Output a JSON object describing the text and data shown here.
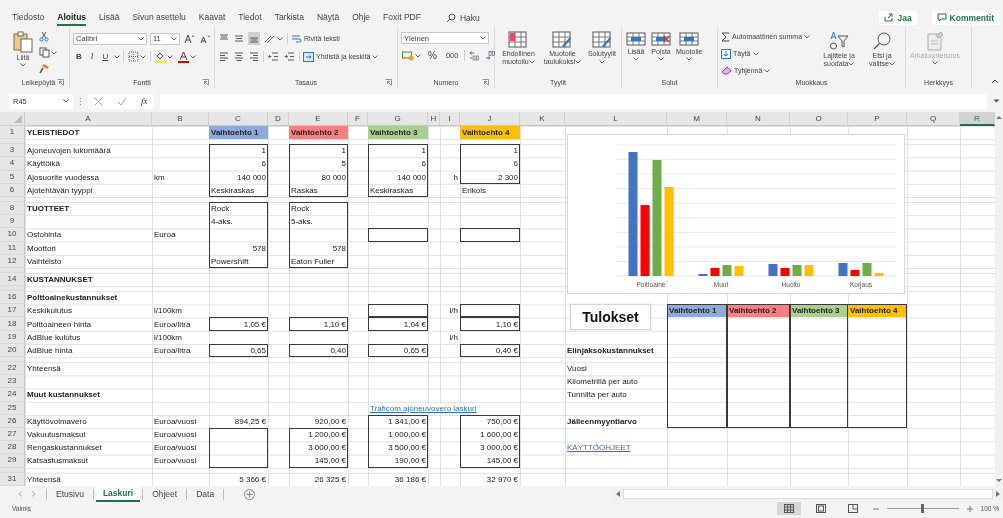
{
  "menu": {
    "tabs": [
      {
        "label": "Tiedosto",
        "selected": false
      },
      {
        "label": "Aloitus",
        "selected": true
      },
      {
        "label": "Lisää",
        "selected": false
      },
      {
        "label": "Sivun asettelu",
        "selected": false
      },
      {
        "label": "Kaavat",
        "selected": false
      },
      {
        "label": "Tiedot",
        "selected": false
      },
      {
        "label": "Tarkista",
        "selected": false
      },
      {
        "label": "Näytä",
        "selected": false
      },
      {
        "label": "Ohje",
        "selected": false
      },
      {
        "label": "Foxit PDF",
        "selected": false
      }
    ],
    "search": "Haku",
    "share": "Jaa",
    "comments": "Kommentit"
  },
  "ribbon": {
    "clipboard": {
      "label": "Leikepöytä",
      "launcher": true,
      "paste": "Liitä"
    },
    "font": {
      "label": "Fontti",
      "launcher": true,
      "family": "Calibri",
      "size": "11",
      "bold": "B",
      "italic": "I",
      "underline": "U"
    },
    "alignment": {
      "label": "Tasaus",
      "launcher": true,
      "vertical": [
        {
          "selected": false
        },
        {
          "selected": false
        },
        {
          "selected": true
        }
      ],
      "wrap": "Rivitä teksti",
      "merge": "Yhdistä ja keskitä"
    },
    "number": {
      "label": "Numero",
      "launcher": true,
      "format": "Yleinen",
      "percent": "%",
      "thousands": "000"
    },
    "styles": {
      "label": "Tyylit",
      "buttons": [
        "Ehdollinen muotoilu",
        "Muotoile taulukoksi",
        "Solutyylit"
      ]
    },
    "cells": {
      "label": "Solut",
      "buttons": [
        "Lisää",
        "Poista",
        "Muotoile"
      ]
    },
    "editing": {
      "label": "Muokkaus",
      "autosum": "Automaattinen summa",
      "fill": "Täytä",
      "clear": "Tyhjennä",
      "sort": "Lajittele ja suodata",
      "find": "Etsi ja valitse"
    },
    "sensitivity": {
      "label": "Herkkyys",
      "button": "Arkaluonteisuus",
      "disabled": true
    }
  },
  "formula_bar": {
    "name_box": "R45",
    "function_label": "fx"
  },
  "sheet": {
    "columns": [
      {
        "label": "A",
        "selected": false
      },
      {
        "label": "B",
        "selected": false
      },
      {
        "label": "C",
        "selected": false
      },
      {
        "label": "D",
        "selected": false
      },
      {
        "label": "E",
        "selected": false
      },
      {
        "label": "F",
        "selected": false
      },
      {
        "label": "G",
        "selected": false
      },
      {
        "label": "H",
        "selected": false
      },
      {
        "label": "I",
        "selected": false
      },
      {
        "label": "J",
        "selected": false
      },
      {
        "label": "K",
        "selected": false
      },
      {
        "label": "L",
        "selected": false
      },
      {
        "label": "M",
        "selected": false
      },
      {
        "label": "N",
        "selected": false
      },
      {
        "label": "O",
        "selected": false
      },
      {
        "label": "P",
        "selected": false
      },
      {
        "label": "Q",
        "selected": false
      },
      {
        "label": "R",
        "selected": true
      }
    ],
    "rows": [
      {
        "number": "1",
        "small": false,
        "cells": {
          "A": {
            "kind": "heading",
            "text": "YLEISTIEDOT"
          },
          "C": {
            "kind": "header",
            "text": "Vaihtoehto 1",
            "color": "#8eaadb"
          },
          "E": {
            "kind": "header",
            "text": "Vaihtoehto 2",
            "color": "#ff7c80"
          },
          "G": {
            "kind": "header",
            "text": "Vaihtoehto 3",
            "color": "#a9d08e"
          },
          "J": {
            "kind": "header",
            "text": "Vaihtoehto 4",
            "color": "#ffc000"
          }
        }
      },
      {
        "small": true
      },
      {
        "number": "3",
        "small": false,
        "cells": {
          "A": {
            "kind": "text",
            "text": "Ajoneuvojen lukumäärä"
          },
          "C": {
            "kind": "number",
            "text": "1"
          },
          "E": {
            "kind": "number",
            "text": "1"
          },
          "G": {
            "kind": "number",
            "text": "1"
          },
          "J": {
            "kind": "number",
            "text": "1"
          }
        }
      },
      {
        "number": "4",
        "small": false,
        "cells": {
          "A": {
            "kind": "text",
            "text": "Käyttöikä"
          },
          "C": {
            "kind": "number",
            "text": "6"
          },
          "E": {
            "kind": "number",
            "text": "5"
          },
          "G": {
            "kind": "number",
            "text": "6"
          },
          "J": {
            "kind": "number",
            "text": "6"
          }
        }
      },
      {
        "number": "5",
        "small": false,
        "cells": {
          "A": {
            "kind": "text",
            "text": "Ajosuorite vuodessa"
          },
          "B": {
            "kind": "text",
            "text": "km"
          },
          "C": {
            "kind": "number",
            "text": "140 000"
          },
          "E": {
            "kind": "number",
            "text": "80 000"
          },
          "G": {
            "kind": "number",
            "text": "140 000"
          },
          "I": {
            "kind": "number",
            "text": "h"
          },
          "J": {
            "kind": "number",
            "text": "2 300"
          }
        }
      },
      {
        "number": "6",
        "small": false,
        "cells": {
          "A": {
            "kind": "text",
            "text": "Ajotehtävän tyyppi"
          },
          "C": {
            "kind": "text",
            "text": "Keskiraskas"
          },
          "E": {
            "kind": "text",
            "text": "Raskas"
          },
          "G": {
            "kind": "text",
            "text": "Keskiraskas"
          },
          "J": {
            "kind": "text",
            "text": "Erikois"
          }
        }
      },
      {
        "small": true
      },
      {
        "number": "8",
        "small": false,
        "cells": {
          "A": {
            "kind": "heading",
            "text": "TUOTTEET"
          },
          "C": {
            "kind": "text",
            "text": "Rock"
          },
          "E": {
            "kind": "text",
            "text": "Rock"
          }
        }
      },
      {
        "number": "9",
        "small": false,
        "cells": {
          "C": {
            "kind": "text",
            "text": "4-aks."
          },
          "E": {
            "kind": "text",
            "text": "5-aks."
          }
        }
      },
      {
        "number": "10",
        "small": false,
        "cells": {
          "A": {
            "kind": "text",
            "text": "Ostohinta"
          },
          "B": {
            "kind": "text",
            "text": "Euroa"
          }
        }
      },
      {
        "number": "11",
        "small": false,
        "cells": {
          "A": {
            "kind": "text",
            "text": "Moottori"
          },
          "C": {
            "kind": "number",
            "text": "578"
          },
          "E": {
            "kind": "number",
            "text": "578"
          }
        }
      },
      {
        "number": "12",
        "small": false,
        "cells": {
          "A": {
            "kind": "text",
            "text": "Vaihteisto"
          },
          "C": {
            "kind": "text",
            "text": "Powershift"
          },
          "E": {
            "kind": "text",
            "text": "Eaton Fuller"
          }
        }
      },
      {
        "small": true
      },
      {
        "number": "14",
        "small": false,
        "cells": {
          "A": {
            "kind": "heading",
            "text": "KUSTANNUKSET"
          }
        }
      },
      {
        "small": true
      },
      {
        "number": "16",
        "small": false,
        "cells": {
          "A": {
            "kind": "heading",
            "text": "Polttoainekustannukset"
          }
        }
      },
      {
        "number": "17",
        "small": false,
        "cells": {
          "A": {
            "kind": "text",
            "text": "Keskikulutus"
          },
          "B": {
            "kind": "text",
            "text": "l/100km"
          },
          "I": {
            "kind": "number",
            "text": "l/h"
          },
          "M": {
            "kind": "header",
            "text": "Vaihtoehto 1",
            "color": "#8eaadb"
          },
          "N": {
            "kind": "header",
            "text": "Vaihtoehto 2",
            "color": "#ff7c80"
          },
          "O": {
            "kind": "header",
            "text": "Vaihtoehto 3",
            "color": "#a9d08e"
          },
          "P": {
            "kind": "header",
            "text": "Vaihtoehto 4",
            "color": "#ffc000"
          }
        }
      },
      {
        "number": "18",
        "small": false,
        "cells": {
          "A": {
            "kind": "text",
            "text": "Polttoaineen hinta"
          },
          "B": {
            "kind": "text",
            "text": "Euroa/litra"
          },
          "C": {
            "kind": "number",
            "text": "1,05 €"
          },
          "E": {
            "kind": "number",
            "text": "1,10 €"
          },
          "G": {
            "kind": "number",
            "text": "1,04 €"
          },
          "J": {
            "kind": "number",
            "text": "1,10 €"
          }
        }
      },
      {
        "number": "19",
        "small": false,
        "cells": {
          "A": {
            "kind": "text",
            "text": "AdBlue kulutus"
          },
          "B": {
            "kind": "text",
            "text": "l/100km"
          },
          "I": {
            "kind": "number",
            "text": "l/h"
          }
        }
      },
      {
        "number": "20",
        "small": false,
        "cells": {
          "A": {
            "kind": "text",
            "text": "AdBlue hinta"
          },
          "B": {
            "kind": "text",
            "text": "Euroa/litra"
          },
          "C": {
            "kind": "number",
            "text": "0,65"
          },
          "E": {
            "kind": "number",
            "text": "0,40"
          },
          "G": {
            "kind": "number",
            "text": "0,65 €"
          },
          "J": {
            "kind": "number",
            "text": "0,40 €"
          },
          "L": {
            "kind": "heading",
            "text": "Elinjaksokustannukset"
          }
        }
      },
      {
        "small": true
      },
      {
        "number": "22",
        "small": false,
        "cells": {
          "A": {
            "kind": "text",
            "text": "Yhteensä"
          },
          "L": {
            "kind": "text",
            "text": "Vuosi"
          }
        }
      },
      {
        "number": "23",
        "small": false,
        "cells": {
          "L": {
            "kind": "text",
            "text": "Kilometrillä per auto"
          }
        }
      },
      {
        "number": "24",
        "small": false,
        "cells": {
          "A": {
            "kind": "heading",
            "text": "Muut kustannukset"
          },
          "L": {
            "kind": "text",
            "text": "Tunnilta per auto"
          }
        }
      },
      {
        "number": "25",
        "small": false,
        "cells": {
          "G": {
            "kind": "link",
            "text": "Traficom ajoneuvovero laskuri"
          }
        }
      },
      {
        "number": "26",
        "small": false,
        "cells": {
          "A": {
            "kind": "text",
            "text": "Käyttövoimavero"
          },
          "B": {
            "kind": "text",
            "text": "Euroa/vuosi"
          },
          "C": {
            "kind": "number",
            "text": "894,25 €"
          },
          "E": {
            "kind": "number",
            "text": "920,00 €"
          },
          "G": {
            "kind": "number",
            "text": "1 341,00 €"
          },
          "J": {
            "kind": "number",
            "text": "750,00 €"
          },
          "L": {
            "kind": "heading",
            "text": "Jälleenmyyntiarvo"
          }
        }
      },
      {
        "number": "27",
        "small": false,
        "cells": {
          "A": {
            "kind": "text",
            "text": "Vakuutusmaksut"
          },
          "B": {
            "kind": "text",
            "text": "Euroa/vuosi"
          },
          "E": {
            "kind": "number",
            "text": "1 200,00 €"
          },
          "G": {
            "kind": "number",
            "text": "1 000,00 €"
          },
          "J": {
            "kind": "number",
            "text": "1 600,00 €"
          }
        }
      },
      {
        "number": "28",
        "small": false,
        "cells": {
          "A": {
            "kind": "text",
            "text": "Rengaskustannukset"
          },
          "B": {
            "kind": "text",
            "text": "Euroa/vuosi"
          },
          "E": {
            "kind": "number",
            "text": "3 000,00 €"
          },
          "G": {
            "kind": "number",
            "text": "3 500,00 €"
          },
          "J": {
            "kind": "number",
            "text": "3 000,00 €"
          },
          "L": {
            "kind": "link",
            "text": "KÄYTTÖOHJEET"
          }
        }
      },
      {
        "number": "29",
        "small": false,
        "cells": {
          "A": {
            "kind": "text",
            "text": "Katsastusmaksut"
          },
          "B": {
            "kind": "text",
            "text": "Euroa/vuosi"
          },
          "E": {
            "kind": "number",
            "text": "145,00 €"
          },
          "G": {
            "kind": "number",
            "text": "190,00 €"
          },
          "J": {
            "kind": "number",
            "text": "145,00 €"
          }
        }
      },
      {
        "small": true
      },
      {
        "number": "31",
        "small": false,
        "cells": {
          "A": {
            "kind": "text",
            "text": "Yhteensä"
          },
          "C": {
            "kind": "number",
            "text": "5 366 €"
          },
          "E": {
            "kind": "number",
            "text": "26 325 €"
          },
          "G": {
            "kind": "number",
            "text": "36 186 €"
          },
          "J": {
            "kind": "number",
            "text": "32 970 €"
          }
        }
      }
    ],
    "borders": {
      "C3:C6": true,
      "E3:E6": true,
      "G3:G6": true,
      "J3:J5": true,
      "C8:C12": true,
      "E8:E12": true,
      "G10:G10": true,
      "J10:J10": true,
      "G17:G17": true,
      "J17:J17": true,
      "C18:C18": true,
      "E18:E18": true,
      "G18:G18": true,
      "J18:J18": true,
      "C20:C20": true,
      "E20:E20": true,
      "G20:G20": true,
      "J20:J20": true,
      "C27:C29": true,
      "E27:E29": true,
      "G26:G29": true,
      "J26:J29": true,
      "M17:P26": true,
      "M17:M26": true,
      "N17:N26": true,
      "O17:O26": true
    },
    "chart_labels": [
      "Polttoaine",
      "Muut",
      "Huolto",
      "Korjaus"
    ],
    "results_title": "Tulokset"
  },
  "sheet_tabs": [
    {
      "label": "Etusivu",
      "selected": false
    },
    {
      "label": "Laskuri",
      "selected": true
    },
    {
      "label": "Ohjeet",
      "selected": false
    },
    {
      "label": "Data",
      "selected": false
    }
  ],
  "status_bar": {
    "status": "Valmis",
    "views": [
      {
        "selected": true
      },
      {
        "selected": false
      },
      {
        "selected": false
      }
    ],
    "zoom": {
      "level": 0.5,
      "reading": "100 %"
    }
  }
}
